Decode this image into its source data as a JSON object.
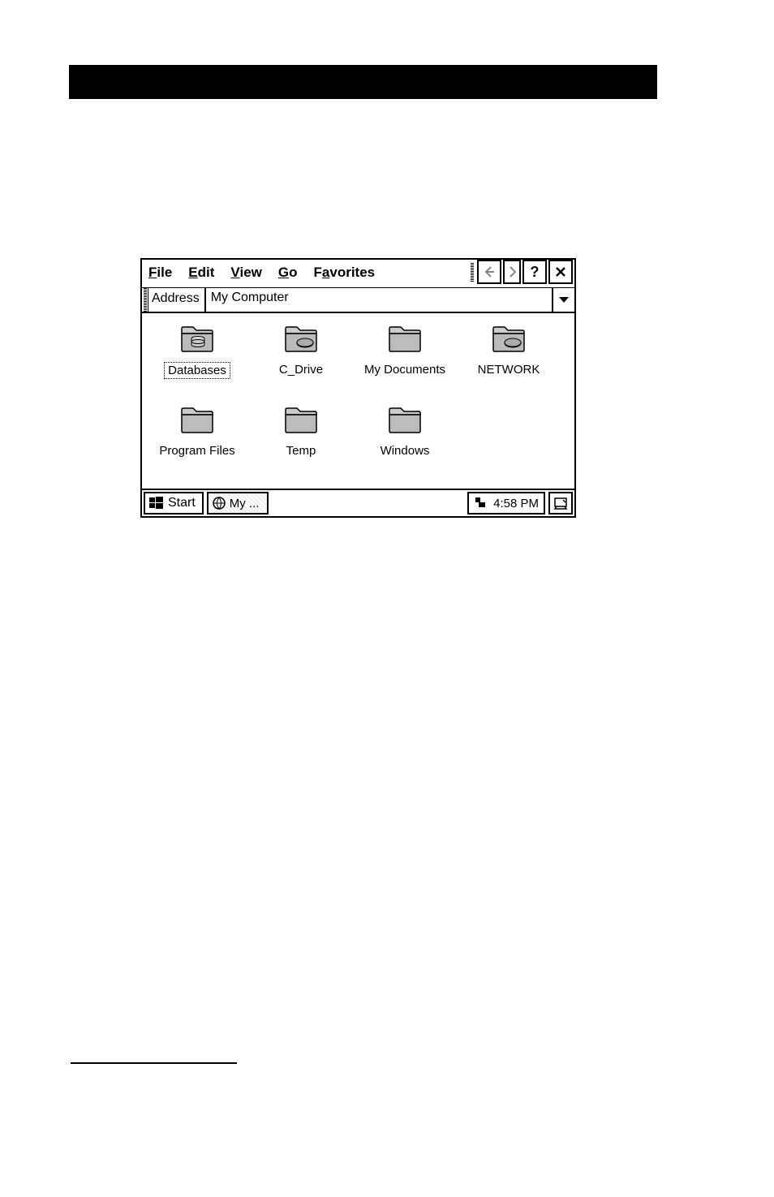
{
  "menu": {
    "file": "File",
    "edit": "Edit",
    "view": "View",
    "go": "Go",
    "favorites": "Favorites"
  },
  "toolbar": {
    "back": "Back",
    "forward": "Forward",
    "help": "?",
    "close": "Close"
  },
  "address": {
    "label": "Address",
    "value": "My Computer"
  },
  "items": [
    {
      "label": "Databases",
      "type": "database",
      "selected": true
    },
    {
      "label": "C_Drive",
      "type": "drive",
      "selected": false
    },
    {
      "label": "My Documents",
      "type": "folder",
      "selected": false
    },
    {
      "label": "NETWORK",
      "type": "drive",
      "selected": false
    },
    {
      "label": "Program Files",
      "type": "folder",
      "selected": false
    },
    {
      "label": "Temp",
      "type": "folder",
      "selected": false
    },
    {
      "label": "Windows",
      "type": "folder",
      "selected": false
    }
  ],
  "taskbar": {
    "start": "Start",
    "task1": "My ...",
    "clock": "4:58 PM"
  }
}
